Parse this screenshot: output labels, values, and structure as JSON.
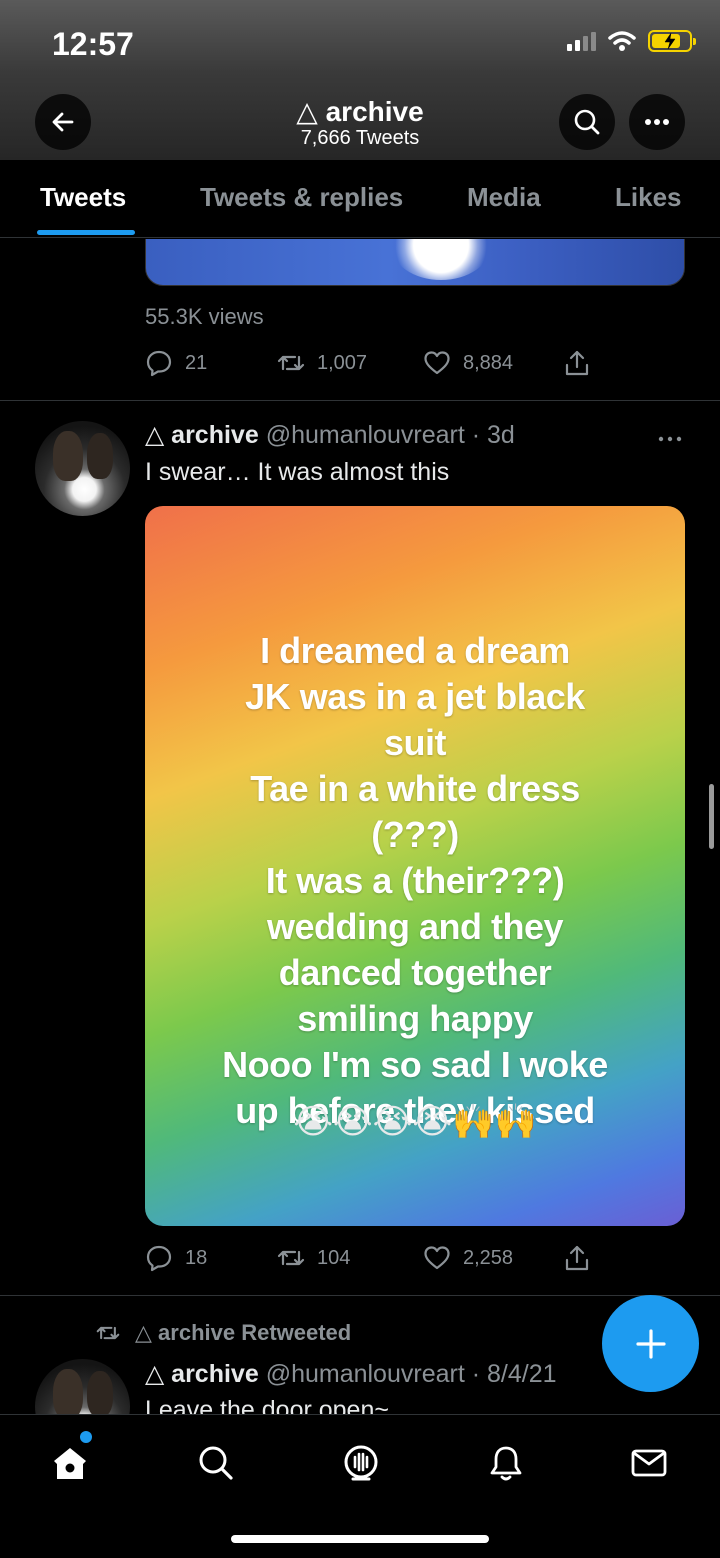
{
  "status_bar": {
    "time": "12:57"
  },
  "header": {
    "title": "△ archive",
    "subtitle": "7,666 Tweets"
  },
  "tabs": [
    {
      "label": "Tweets",
      "active": true
    },
    {
      "label": "Tweets & replies",
      "active": false
    },
    {
      "label": "Media",
      "active": false
    },
    {
      "label": "Likes",
      "active": false
    }
  ],
  "prev_tweet": {
    "views": "55.3K views",
    "replies": "21",
    "retweets": "1,007",
    "likes": "8,884"
  },
  "tweet": {
    "name": "△ archive",
    "meta": "@humanlouvreart · 3d",
    "text": "I swear… It was almost this",
    "image_lines": [
      "I dreamed a dream",
      "JK was in a jet black",
      "suit",
      "Tae in a white dress",
      "(???)",
      "It was a (their???)",
      "wedding and they",
      "danced together",
      "smiling happy",
      "Nooo I'm so sad I woke",
      "up before they kissed"
    ],
    "image_emojis": "😭😭😭😭🙌🙌",
    "replies": "18",
    "retweets": "104",
    "likes": "2,258"
  },
  "next_tweet": {
    "retweet_label": "△ archive Retweeted",
    "name": "△ archive",
    "meta": "@humanlouvreart · 8/4/21",
    "text": "Leave the door open~"
  },
  "colors": {
    "accent": "#1d9bf0",
    "background": "#000000",
    "secondary_text": "#8b9196"
  },
  "icons": {
    "back": "arrow-left-icon",
    "search": "search-icon",
    "more": "more-icon",
    "compose": "plus-icon",
    "home": "home-icon",
    "explore": "search-icon",
    "spaces": "microphone-icon",
    "notifications": "bell-icon",
    "messages": "envelope-icon"
  }
}
